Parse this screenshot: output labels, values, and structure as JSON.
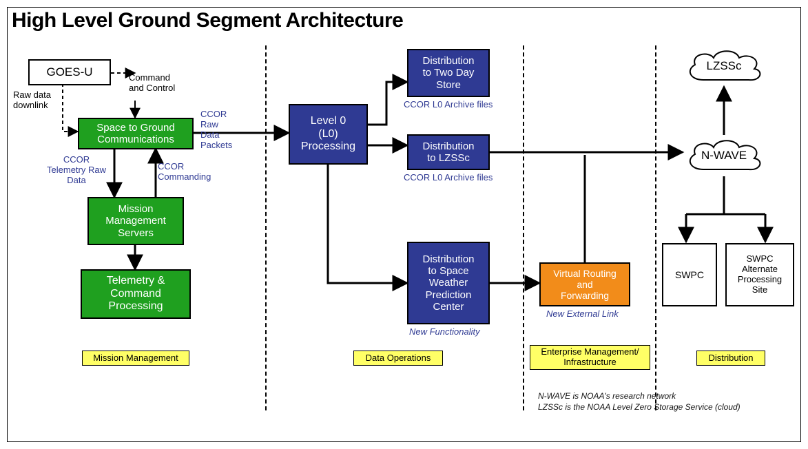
{
  "title": "High Level Ground Segment Architecture",
  "boxes": {
    "goes_u": "GOES-U",
    "s2g": "Space to Ground\nCommunications",
    "mms": "Mission\nManagement\nServers",
    "tcp": "Telemetry &\nCommand\nProcessing",
    "l0": "Level 0\n(L0)\nProcessing",
    "dist_2day": "Distribution\nto Two Day\nStore",
    "dist_lzssc": "Distribution\nto LZSSc",
    "dist_swpc": "Distribution\nto Space\nWeather\nPrediction\nCenter",
    "vrf": "Virtual Routing\nand\nForwarding",
    "swpc": "SWPC",
    "swpc_alt": "SWPC\nAlternate\nProcessing\nSite"
  },
  "clouds": {
    "nwave": "N-WAVE",
    "lzssc": "LZSSc"
  },
  "labels": {
    "cmd_ctrl": "Command\nand Control",
    "raw_downlink": "Raw data\ndownlink",
    "ccor_raw_packets": "CCOR\nRaw\nData\nPackets",
    "ccor_tlm_raw": "CCOR\nTelemetry Raw\nData",
    "ccor_cmd": "CCOR\nCommanding",
    "ccor_l0_archive_1": "CCOR L0 Archive files",
    "ccor_l0_archive_2": "CCOR L0 Archive files",
    "new_func": "New Functionality",
    "new_ext": "New External Link",
    "foot1": "N-WAVE is NOAA's research network",
    "foot2": "LZSSc is the NOAA Level Zero Storage Service (cloud)"
  },
  "sections": {
    "mm": "Mission Management",
    "do": "Data Operations",
    "emi": "Enterprise Management/\nInfrastructure",
    "dist": "Distribution"
  }
}
